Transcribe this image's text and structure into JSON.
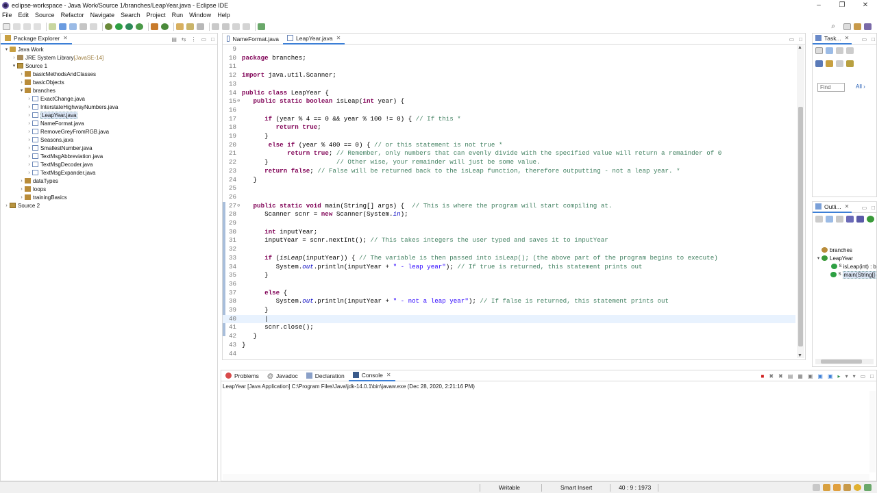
{
  "window": {
    "title": "eclipse-workspace - Java Work/Source 1/branches/LeapYear.java - Eclipse IDE",
    "controls": [
      "–",
      "❐",
      "✕"
    ]
  },
  "menu": [
    "File",
    "Edit",
    "Source",
    "Refactor",
    "Navigate",
    "Search",
    "Project",
    "Run",
    "Window",
    "Help"
  ],
  "package_explorer": {
    "tab_label": "Package Explorer",
    "tree": [
      {
        "label": "Java Work",
        "depth": 0,
        "arrow": "▾",
        "icon": "project"
      },
      {
        "label": "JRE System Library",
        "suffix": " [JavaSE-14]",
        "depth": 1,
        "arrow": "›",
        "icon": "lib"
      },
      {
        "label": "Source 1",
        "depth": 1,
        "arrow": "▾",
        "icon": "src"
      },
      {
        "label": "basicMethodsAndClasses",
        "depth": 2,
        "arrow": "›",
        "icon": "pkg"
      },
      {
        "label": "basicObjects",
        "depth": 2,
        "arrow": "›",
        "icon": "pkg"
      },
      {
        "label": "branches",
        "depth": 2,
        "arrow": "▾",
        "icon": "pkg"
      },
      {
        "label": "ExactChange.java",
        "depth": 3,
        "arrow": "›",
        "icon": "java"
      },
      {
        "label": "InterstateHighwayNumbers.java",
        "depth": 3,
        "arrow": "›",
        "icon": "java"
      },
      {
        "label": "LeapYear.java",
        "depth": 3,
        "arrow": "›",
        "icon": "java",
        "selected": true
      },
      {
        "label": "NameFormat.java",
        "depth": 3,
        "arrow": "›",
        "icon": "java"
      },
      {
        "label": "RemoveGreyFromRGB.java",
        "depth": 3,
        "arrow": "›",
        "icon": "java"
      },
      {
        "label": "Seasons.java",
        "depth": 3,
        "arrow": "›",
        "icon": "java"
      },
      {
        "label": "SmallestNumber.java",
        "depth": 3,
        "arrow": "›",
        "icon": "java"
      },
      {
        "label": "TextMsgAbbreviation.java",
        "depth": 3,
        "arrow": "›",
        "icon": "java"
      },
      {
        "label": "TextMsgDecoder.java",
        "depth": 3,
        "arrow": "›",
        "icon": "java"
      },
      {
        "label": "TextMsgExpander.java",
        "depth": 3,
        "arrow": "›",
        "icon": "java"
      },
      {
        "label": "dataTypes",
        "depth": 2,
        "arrow": "›",
        "icon": "pkg"
      },
      {
        "label": "loops",
        "depth": 2,
        "arrow": "›",
        "icon": "pkg"
      },
      {
        "label": "trainingBasics",
        "depth": 2,
        "arrow": "›",
        "icon": "pkg"
      },
      {
        "label": "Source 2",
        "depth": 0,
        "arrow": "›",
        "icon": "src"
      }
    ]
  },
  "editor": {
    "tabs": [
      {
        "label": "NameFormat.java",
        "active": false
      },
      {
        "label": "LeapYear.java",
        "active": true
      }
    ],
    "current_line": 40,
    "lines": [
      {
        "n": "9",
        "h": ""
      },
      {
        "n": "10",
        "h": "<span class=\"kw\">package</span> branches;"
      },
      {
        "n": "11",
        "h": ""
      },
      {
        "n": "12",
        "h": "<span class=\"kw\">import</span> java.util.Scanner;"
      },
      {
        "n": "13",
        "h": ""
      },
      {
        "n": "14",
        "h": "<span class=\"kw\">public</span> <span class=\"kw\">class</span> LeapYear {"
      },
      {
        "n": "15",
        "fold": "⊖",
        "h": "   <span class=\"kw\">public</span> <span class=\"kw\">static</span> <span class=\"kw\">boolean</span> isLeap(<span class=\"kw\">int</span> year) {"
      },
      {
        "n": "16",
        "h": ""
      },
      {
        "n": "17",
        "h": "      <span class=\"kw\">if</span> (year % 4 == 0 &amp;&amp; year % 100 != 0) { <span class=\"cm\">// If this *</span>"
      },
      {
        "n": "18",
        "h": "         <span class=\"kw\">return</span> <span class=\"kw\">true</span>;"
      },
      {
        "n": "19",
        "h": "      }"
      },
      {
        "n": "20",
        "h": "       <span class=\"kw\">else</span> <span class=\"kw\">if</span> (year % 400 == 0) { <span class=\"cm\">// or this statement is not true *</span>"
      },
      {
        "n": "21",
        "h": "            <span class=\"kw\">return</span> <span class=\"kw\">true</span>; <span class=\"cm\">// Remember, only numbers that can evenly divide with the specified value will return a remainder of 0</span>"
      },
      {
        "n": "22",
        "h": "      }                  <span class=\"cm\">// Other wise, your remainder will just be some value.</span>"
      },
      {
        "n": "23",
        "h": "      <span class=\"kw\">return</span> <span class=\"kw\">false</span>; <span class=\"cm\">// False will be returned back to the isLeap function, therefore outputting - not a leap year. *</span>"
      },
      {
        "n": "24",
        "h": "   }"
      },
      {
        "n": "25",
        "h": ""
      },
      {
        "n": "26",
        "h": ""
      },
      {
        "n": "27",
        "fold": "⊖",
        "h": "   <span class=\"kw\">public</span> <span class=\"kw\">static</span> <span class=\"kw\">void</span> main(String[] args) {  <span class=\"cm\">// This is where the program will start compiling at.</span>"
      },
      {
        "n": "28",
        "h": "      Scanner scnr = <span class=\"kw\">new</span> Scanner(System.<span class=\"fd\">in</span>);"
      },
      {
        "n": "29",
        "h": ""
      },
      {
        "n": "30",
        "h": "      <span class=\"kw\">int</span> inputYear;"
      },
      {
        "n": "31",
        "h": "      inputYear = scnr.nextInt(); <span class=\"cm\">// This takes integers the user typed and saves it to inputYear</span>"
      },
      {
        "n": "32",
        "h": ""
      },
      {
        "n": "33",
        "h": "      <span class=\"kw\">if</span> (<span class=\"it\">isLeap</span>(inputYear)) { <span class=\"cm\">// The variable is then passed into isLeap(); (the above part of the program begins to execute)</span>"
      },
      {
        "n": "34",
        "h": "         System.<span class=\"fd\">out</span>.println(inputYear + <span class=\"st\">\" - leap year\"</span>); <span class=\"cm\">// If true is returned, this statement prints out</span>"
      },
      {
        "n": "35",
        "h": "      }"
      },
      {
        "n": "36",
        "h": ""
      },
      {
        "n": "37",
        "h": "      <span class=\"kw\">else</span> {"
      },
      {
        "n": "38",
        "h": "         System.<span class=\"fd\">out</span>.println(inputYear + <span class=\"st\">\" - not a leap year\"</span>); <span class=\"cm\">// If false is returned, this statement prints out</span>"
      },
      {
        "n": "39",
        "h": "      }"
      },
      {
        "n": "40",
        "h": "      |"
      },
      {
        "n": "41",
        "h": "      scnr.close();"
      },
      {
        "n": "42",
        "h": "   }"
      },
      {
        "n": "43",
        "h": "}"
      },
      {
        "n": "44",
        "h": ""
      }
    ]
  },
  "task_panel": {
    "tab_label": "Task...",
    "find_placeholder": "Find",
    "all_label": "All",
    "all_arrow": "›"
  },
  "outline_panel": {
    "tab_label": "Outli...",
    "items": [
      {
        "label": "branches",
        "depth": 0
      },
      {
        "label": "LeapYear",
        "depth": 0,
        "arrow": "▾"
      },
      {
        "label": "isLeap(int) : b",
        "depth": 1,
        "prefix": "S"
      },
      {
        "label": "main(String[]",
        "depth": 1,
        "prefix": "S",
        "selected": true
      }
    ]
  },
  "bottom_panel": {
    "tabs": [
      {
        "label": "Problems",
        "active": false
      },
      {
        "label": "Javadoc",
        "active": false
      },
      {
        "label": "Declaration",
        "active": false
      },
      {
        "label": "Console",
        "active": true
      }
    ],
    "launch_info": "LeapYear [Java Application] C:\\Program Files\\Java\\jdk-14.0.1\\bin\\javaw.exe (Dec 28, 2020, 2:21:16 PM)"
  },
  "status": {
    "writable": "Writable",
    "insert_mode": "Smart Insert",
    "position": "40 : 9 : 1973"
  },
  "colors": {
    "keyword": "#7f0055",
    "comment": "#3f7f5f",
    "string": "#2a00ff",
    "field": "#0000c0",
    "current_line": "#e8f2fe",
    "accent": "#3c7fd6"
  }
}
